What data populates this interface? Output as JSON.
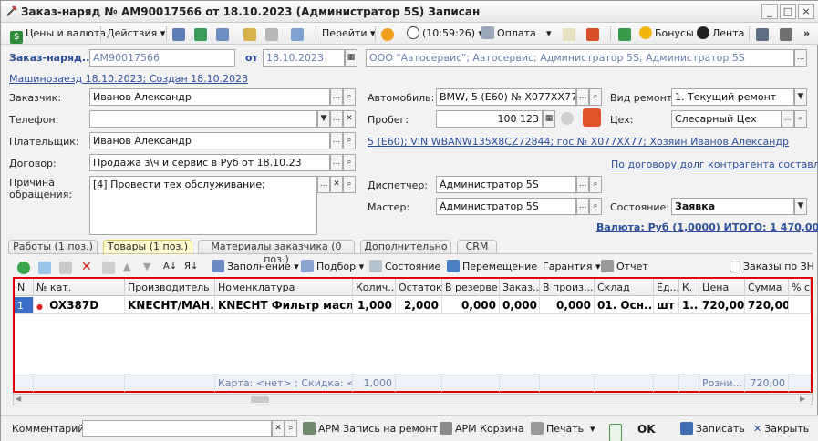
{
  "window": {
    "title": "Заказ-наряд № АМ90017566 от 18.10.2023 (Администратор 5S) Записан",
    "controls": [
      "_",
      "□",
      "×"
    ]
  },
  "toolbar": {
    "items": [
      {
        "label": "Цены и валюта",
        "icon": "dollar-icon"
      },
      {
        "label": "Действия ▾",
        "icon": ""
      },
      {
        "label": "",
        "icon": "doc-icon"
      },
      {
        "label": "",
        "icon": "refresh-icon"
      },
      {
        "label": "",
        "icon": "list-icon"
      },
      {
        "label": "",
        "icon": "export-icon"
      },
      {
        "label": "",
        "icon": "disk-icon"
      },
      {
        "label": "",
        "icon": "copy-icon"
      },
      {
        "label": "Перейти ▾",
        "icon": ""
      },
      {
        "label": "",
        "icon": "help-icon"
      },
      {
        "label": "(10:59:26) ▾",
        "icon": "clock-icon"
      },
      {
        "label": "Оплата",
        "icon": "payment-icon"
      },
      {
        "label": "",
        "icon": "sign-icon"
      },
      {
        "label": "",
        "icon": "scan-icon"
      },
      {
        "label": "",
        "icon": "shop-icon"
      },
      {
        "label": "Бонусы",
        "icon": "coin-icon"
      },
      {
        "label": "Лента",
        "icon": "feed-icon"
      },
      {
        "label": "",
        "icon": "structure-icon"
      },
      {
        "label": "",
        "icon": "table-icon"
      },
      {
        "label": "»",
        "icon": ""
      }
    ]
  },
  "header": {
    "number_label": "Заказ-наряд...",
    "number_value": "АМ90017566",
    "from_label": "от",
    "date_value": "18.10.2023",
    "org_value": "ООО \"Автосервис\"; Автосервис; Администратор 5S; Администратор 5S",
    "visit_link": "Машинозаезд 18.10.2023; Создан 18.10.2023"
  },
  "left_form": {
    "customer_label": "Заказчик:",
    "customer_value": "Иванов Александр",
    "phone_label": "Телефон:",
    "phone_value": "",
    "payer_label": "Плательщик:",
    "payer_value": "Иванов Александр",
    "contract_label": "Договор:",
    "contract_value": "Продажа з\\ч и сервис в Руб от 18.10.23",
    "reason_label": "Причина обращения:",
    "reason_value": "[4] Провести тех обслуживание;"
  },
  "mid_form": {
    "car_label": "Автомобиль:",
    "car_value": "BMW, 5 (E60) № Х077ХХ77 VI",
    "mileage_label": "Пробег:",
    "mileage_value": "100 123",
    "car_link": "5 (E60); VIN WBANW135X8CZ72844; гос № Х077ХХ77; Хозяин Иванов Александр",
    "debt_link": "По договору долг контрагента составля...",
    "dispatcher_label": "Диспетчер:",
    "dispatcher_value": "Администратор 5S",
    "master_label": "Мастер:",
    "master_value": "Администратор 5S"
  },
  "right_form": {
    "repair_type_label": "Вид ремонта:",
    "repair_type_value": "1. Текущий ремонт",
    "shop_label": "Цех:",
    "shop_value": "Слесарный Цех",
    "state_label": "Состояние:",
    "state_value": "Заявка",
    "total_link": "Валюта: Руб (1,0000) ИТОГО: 1 470,00"
  },
  "tabs": [
    {
      "label": "Работы (1 поз.)",
      "active": false
    },
    {
      "label": "Товары (1 поз.)",
      "active": true
    },
    {
      "label": "Материалы заказчика (0 поз.)",
      "active": false
    },
    {
      "label": "Дополнительно",
      "active": false
    },
    {
      "label": "CRM",
      "active": false
    }
  ],
  "grid_toolbar": {
    "fill_label": "Заполнение ▾",
    "select_label": "Подбор ▾",
    "state_label": "Состояние",
    "move_label": "Перемещение",
    "warranty_label": "Гарантия ▾",
    "report_label": "Отчет",
    "orders_check_label": "Заказы по ЗН"
  },
  "grid": {
    "columns": [
      "N",
      "№ кат.",
      "Производитель",
      "Номенклатура",
      "Колич...",
      "Остаток",
      "В резерве",
      "Заказ...",
      "В произ...",
      "Склад",
      "Ед...",
      "К.",
      "Цена",
      "Сумма",
      "% с."
    ],
    "rows": [
      [
        "1",
        "● OX387D",
        "KNECHT/MAH...",
        "KNECHT Фильтр масл...",
        "1,000",
        "2,000",
        "0,000",
        "0,000",
        "0,000",
        "01. Осн...",
        "шт",
        "1...",
        "720,00",
        "720,00",
        ""
      ]
    ],
    "footer": [
      "",
      "",
      "",
      "Карта: <нет> ; Скидка: <...",
      "1,000",
      "",
      "",
      "",
      "",
      "",
      "",
      "",
      "Розни...",
      "720,00",
      ""
    ]
  },
  "bottom": {
    "comment_label": "Комментарий:",
    "comment_value": "",
    "arm_record_label": "АРМ Запись на ремонт",
    "arm_cart_label": "АРМ Корзина",
    "print_label": "Печать",
    "ok_label": "OK",
    "save_label": "Записать",
    "close_label": "Закрыть"
  }
}
